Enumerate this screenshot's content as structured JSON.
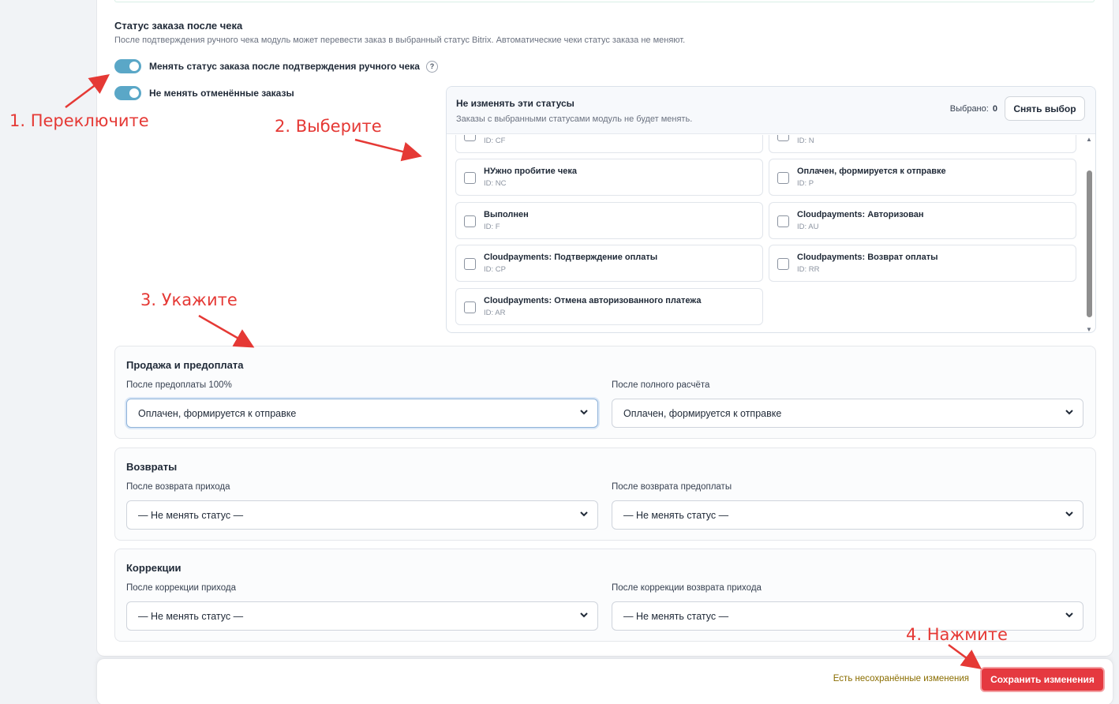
{
  "section": {
    "title": "Статус заказа после чека",
    "description": "После подтверждения ручного чека модуль может перевести заказ в выбранный статус Bitrix. Автоматические чеки статус заказа не меняют."
  },
  "toggles": [
    {
      "label": "Менять статус заказа после подтверждения ручного чека",
      "help": "?",
      "on": true
    },
    {
      "label": "Не менять отменённые заказы",
      "on": true
    }
  ],
  "status_box": {
    "title": "Не изменять эти статусы",
    "subtitle": "Заказы с выбранными статусами модуль не будет менять.",
    "picked_label": "Выбрано:",
    "picked_count": "0",
    "clear_button": "Снять выбор",
    "options": [
      {
        "name": "",
        "id": "ID: CF"
      },
      {
        "name": "",
        "id": "ID: N"
      },
      {
        "name": "НУжно пробитие чека",
        "id": "ID: NC"
      },
      {
        "name": "Оплачен, формируется к отправке",
        "id": "ID: P"
      },
      {
        "name": "Выполнен",
        "id": "ID: F"
      },
      {
        "name": "Cloudpayments: Авторизован",
        "id": "ID: AU"
      },
      {
        "name": "Cloudpayments: Подтверждение оплаты",
        "id": "ID: CP"
      },
      {
        "name": "Cloudpayments: Возврат оплаты",
        "id": "ID: RR"
      },
      {
        "name": "Cloudpayments: Отмена авторизованного платежа",
        "id": "ID: AR"
      }
    ]
  },
  "groups": [
    {
      "title": "Продажа и предоплата",
      "fields": [
        {
          "label": "После предоплаты 100%",
          "value": "Оплачен, формируется к отправке"
        },
        {
          "label": "После полного расчёта",
          "value": "Оплачен, формируется к отправке"
        }
      ]
    },
    {
      "title": "Возвраты",
      "fields": [
        {
          "label": "После возврата прихода",
          "value": "— Не менять статус —"
        },
        {
          "label": "После возврата предоплаты",
          "value": "— Не менять статус —"
        }
      ]
    },
    {
      "title": "Коррекции",
      "fields": [
        {
          "label": "После коррекции прихода",
          "value": "— Не менять статус —"
        },
        {
          "label": "После коррекции возврата прихода",
          "value": "— Не менять статус —"
        }
      ]
    }
  ],
  "annotations": [
    "1. Переключите",
    "2. Выберите",
    "3. Укажите",
    "4. Нажмите"
  ],
  "savebar": {
    "unsaved": "Есть несохранённые изменения",
    "save_button": "Сохранить изменения"
  },
  "colors": {
    "accent_toggle": "#5aa7c7",
    "save_button": "#e53940",
    "annotation": "#e53935"
  }
}
